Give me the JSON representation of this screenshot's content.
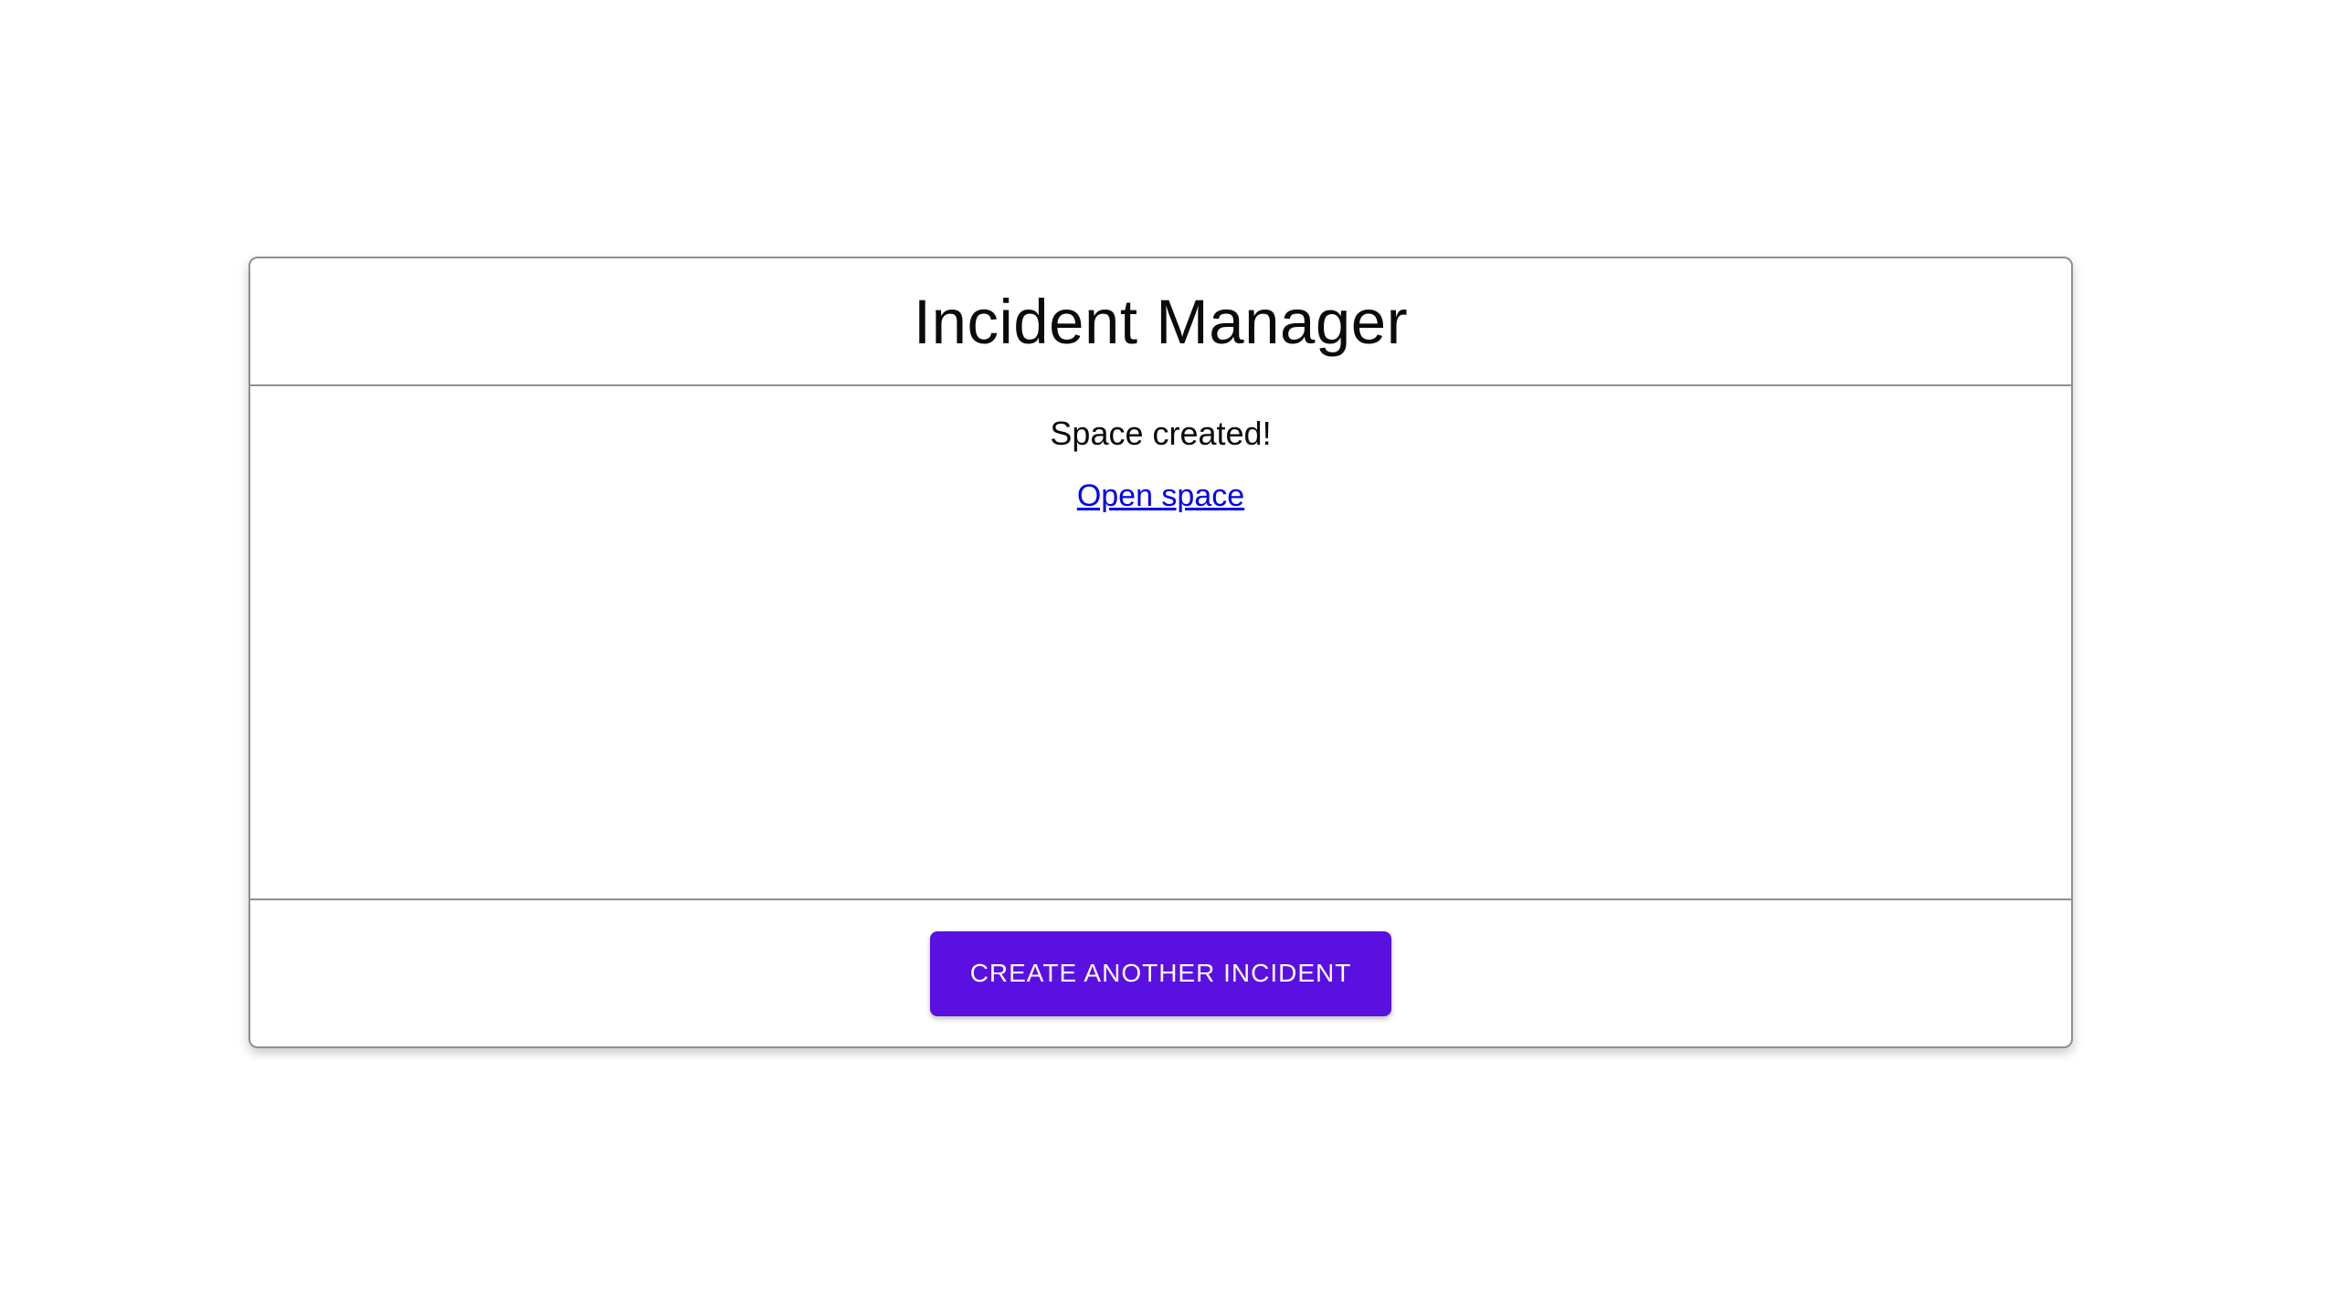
{
  "app": {
    "title": "Incident Manager"
  },
  "content": {
    "status_message": "Space created!",
    "open_space_link_label": "Open space"
  },
  "actions": {
    "create_another_label": "CREATE ANOTHER INCIDENT"
  },
  "colors": {
    "primary": "#5a10e1",
    "link": "#0000ee",
    "border": "#8f8f8f"
  }
}
